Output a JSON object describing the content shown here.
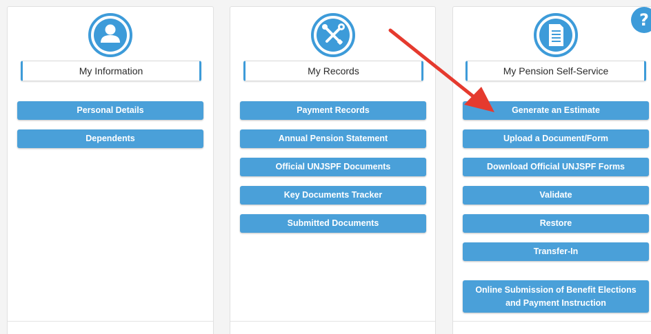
{
  "colors": {
    "accent": "#3d9bd9",
    "button": "#4aa0d9",
    "arrow": "#e53a2e"
  },
  "cards": [
    {
      "title": "My Information",
      "icon": "person-icon",
      "buttons": [
        "Personal Details",
        "Dependents"
      ]
    },
    {
      "title": "My Records",
      "icon": "tools-icon",
      "buttons": [
        "Payment Records",
        "Annual Pension Statement",
        "Official UNJSPF Documents",
        "Key Documents Tracker",
        "Submitted Documents"
      ]
    },
    {
      "title": "My Pension Self-Service",
      "icon": "document-icon",
      "buttons": [
        "Generate an Estimate",
        "Upload a Document/Form",
        "Download Official UNJSPF Forms",
        "Validate",
        "Restore",
        "Transfer-In"
      ],
      "tall_button": {
        "line1": "Online Submission of Benefit Elections",
        "line2": "and Payment Instruction"
      }
    }
  ],
  "help": {
    "icon": "help-icon",
    "glyph": "?"
  }
}
